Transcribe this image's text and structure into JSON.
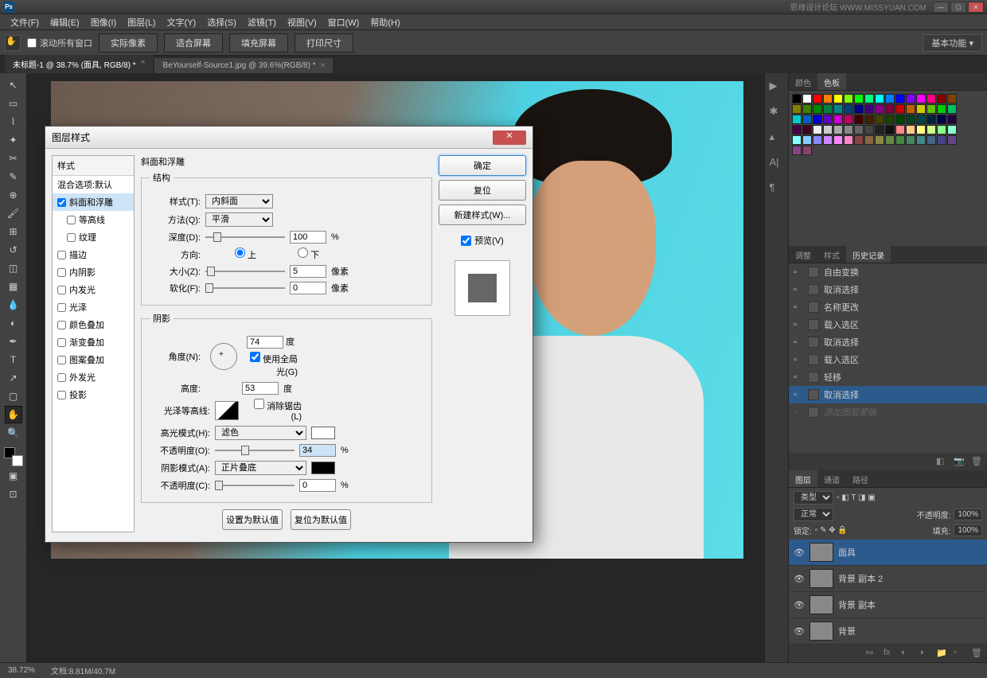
{
  "titlebar": {
    "watermark": "思缘设计论坛  WWW.MISSYUAN.COM"
  },
  "menu": [
    "文件(F)",
    "编辑(E)",
    "图像(I)",
    "图层(L)",
    "文字(Y)",
    "选择(S)",
    "滤镜(T)",
    "视图(V)",
    "窗口(W)",
    "帮助(H)"
  ],
  "optbar": {
    "scrollAll": "滚动所有窗口",
    "btns": [
      "实际像素",
      "适合屏幕",
      "填充屏幕",
      "打印尺寸"
    ],
    "mode": "基本功能"
  },
  "tabs": [
    {
      "label": "未标题-1 @ 38.7% (面具, RGB/8) *",
      "active": true
    },
    {
      "label": "BeYourself-Source1.jpg @ 39.6%(RGB/8) *",
      "active": false
    }
  ],
  "swatchColors": [
    "#000",
    "#fff",
    "#f00",
    "#ff8000",
    "#ff0",
    "#80ff00",
    "#0f0",
    "#00ff80",
    "#0ff",
    "#0080ff",
    "#00f",
    "#8000ff",
    "#f0f",
    "#ff0080",
    "#800",
    "#804000",
    "#808000",
    "#408000",
    "#080",
    "#008040",
    "#088",
    "#004080",
    "#008",
    "#400080",
    "#808",
    "#800040",
    "#c00",
    "#c06000",
    "#cc0",
    "#60c000",
    "#0c0",
    "#00c060",
    "#0cc",
    "#0060c0",
    "#00c",
    "#6000c0",
    "#c0c",
    "#c00060",
    "#400",
    "#402000",
    "#440",
    "#204000",
    "#040",
    "#004020",
    "#044",
    "#002040",
    "#004",
    "#200040",
    "#404",
    "#400020",
    "#eee",
    "#ccc",
    "#aaa",
    "#888",
    "#666",
    "#444",
    "#222",
    "#111",
    "#f88",
    "#fc8",
    "#ff8",
    "#cf8",
    "#8f8",
    "#8fc",
    "#8ff",
    "#8cf",
    "#88f",
    "#c8f",
    "#f8f",
    "#f8c",
    "#844",
    "#864",
    "#884",
    "#684",
    "#484",
    "#486",
    "#488",
    "#468",
    "#448",
    "#648",
    "#848",
    "#846"
  ],
  "panels": {
    "colorTab": "颜色",
    "swatchTab": "色板",
    "adjTab": "调整",
    "styleTab": "样式",
    "histTab": "历史记录",
    "layersTab": "图层",
    "chanTab": "通道",
    "pathTab": "路径"
  },
  "history": [
    {
      "t": "自由变换"
    },
    {
      "t": "取消选择"
    },
    {
      "t": "名称更改"
    },
    {
      "t": "载入选区"
    },
    {
      "t": "取消选择"
    },
    {
      "t": "载入选区"
    },
    {
      "t": "轻移"
    },
    {
      "t": "取消选择",
      "sel": true
    },
    {
      "t": "添加图层蒙版",
      "dim": true
    }
  ],
  "layerOpts": {
    "kind": "类型",
    "blend": "正常",
    "opacityLabel": "不透明度:",
    "opacity": "100%",
    "lockLabel": "锁定:",
    "fillLabel": "填充:",
    "fill": "100%"
  },
  "layers": [
    {
      "name": "面具",
      "sel": true
    },
    {
      "name": "背景 副本 2"
    },
    {
      "name": "背景 副本"
    },
    {
      "name": "背景"
    }
  ],
  "status": {
    "zoom": "38.72%",
    "doc": "文档:8.81M/40.7M"
  },
  "dialog": {
    "title": "图层样式",
    "leftHeader": "样式",
    "blendDefault": "混合选项:默认",
    "styles": [
      {
        "t": "斜面和浮雕",
        "chk": true,
        "sel": true
      },
      {
        "t": "等高线",
        "chk": false,
        "indent": true
      },
      {
        "t": "纹理",
        "chk": false,
        "indent": true
      },
      {
        "t": "描边",
        "chk": false
      },
      {
        "t": "内阴影",
        "chk": false
      },
      {
        "t": "内发光",
        "chk": false
      },
      {
        "t": "光泽",
        "chk": false
      },
      {
        "t": "颜色叠加",
        "chk": false
      },
      {
        "t": "渐变叠加",
        "chk": false
      },
      {
        "t": "图案叠加",
        "chk": false
      },
      {
        "t": "外发光",
        "chk": false
      },
      {
        "t": "投影",
        "chk": false
      }
    ],
    "sectionTitle": "斜面和浮雕",
    "structure": "结构",
    "styleLabel": "样式(T):",
    "styleVal": "内斜面",
    "techLabel": "方法(Q):",
    "techVal": "平滑",
    "depthLabel": "深度(D):",
    "depthVal": "100",
    "pct": "%",
    "dirLabel": "方向:",
    "up": "上",
    "down": "下",
    "sizeLabel": "大小(Z):",
    "sizeVal": "5",
    "px": "像素",
    "softLabel": "软化(F):",
    "softVal": "0",
    "shading": "阴影",
    "angleLabel": "角度(N):",
    "angleVal": "74",
    "deg": "度",
    "globalLight": "使用全局光(G)",
    "altLabel": "高度:",
    "altVal": "53",
    "glossLabel": "光泽等高线:",
    "antialias": "消除锯齿(L)",
    "hlModeLabel": "高光模式(H):",
    "hlModeVal": "滤色",
    "hlOpLabel": "不透明度(O):",
    "hlOpVal": "34",
    "shModeLabel": "阴影模式(A):",
    "shModeVal": "正片叠底",
    "shOpLabel": "不透明度(C):",
    "shOpVal": "0",
    "setDefault": "设置为默认值",
    "resetDefault": "复位为默认值",
    "ok": "确定",
    "cancel": "复位",
    "newStyle": "新建样式(W)...",
    "preview": "预览(V)"
  }
}
